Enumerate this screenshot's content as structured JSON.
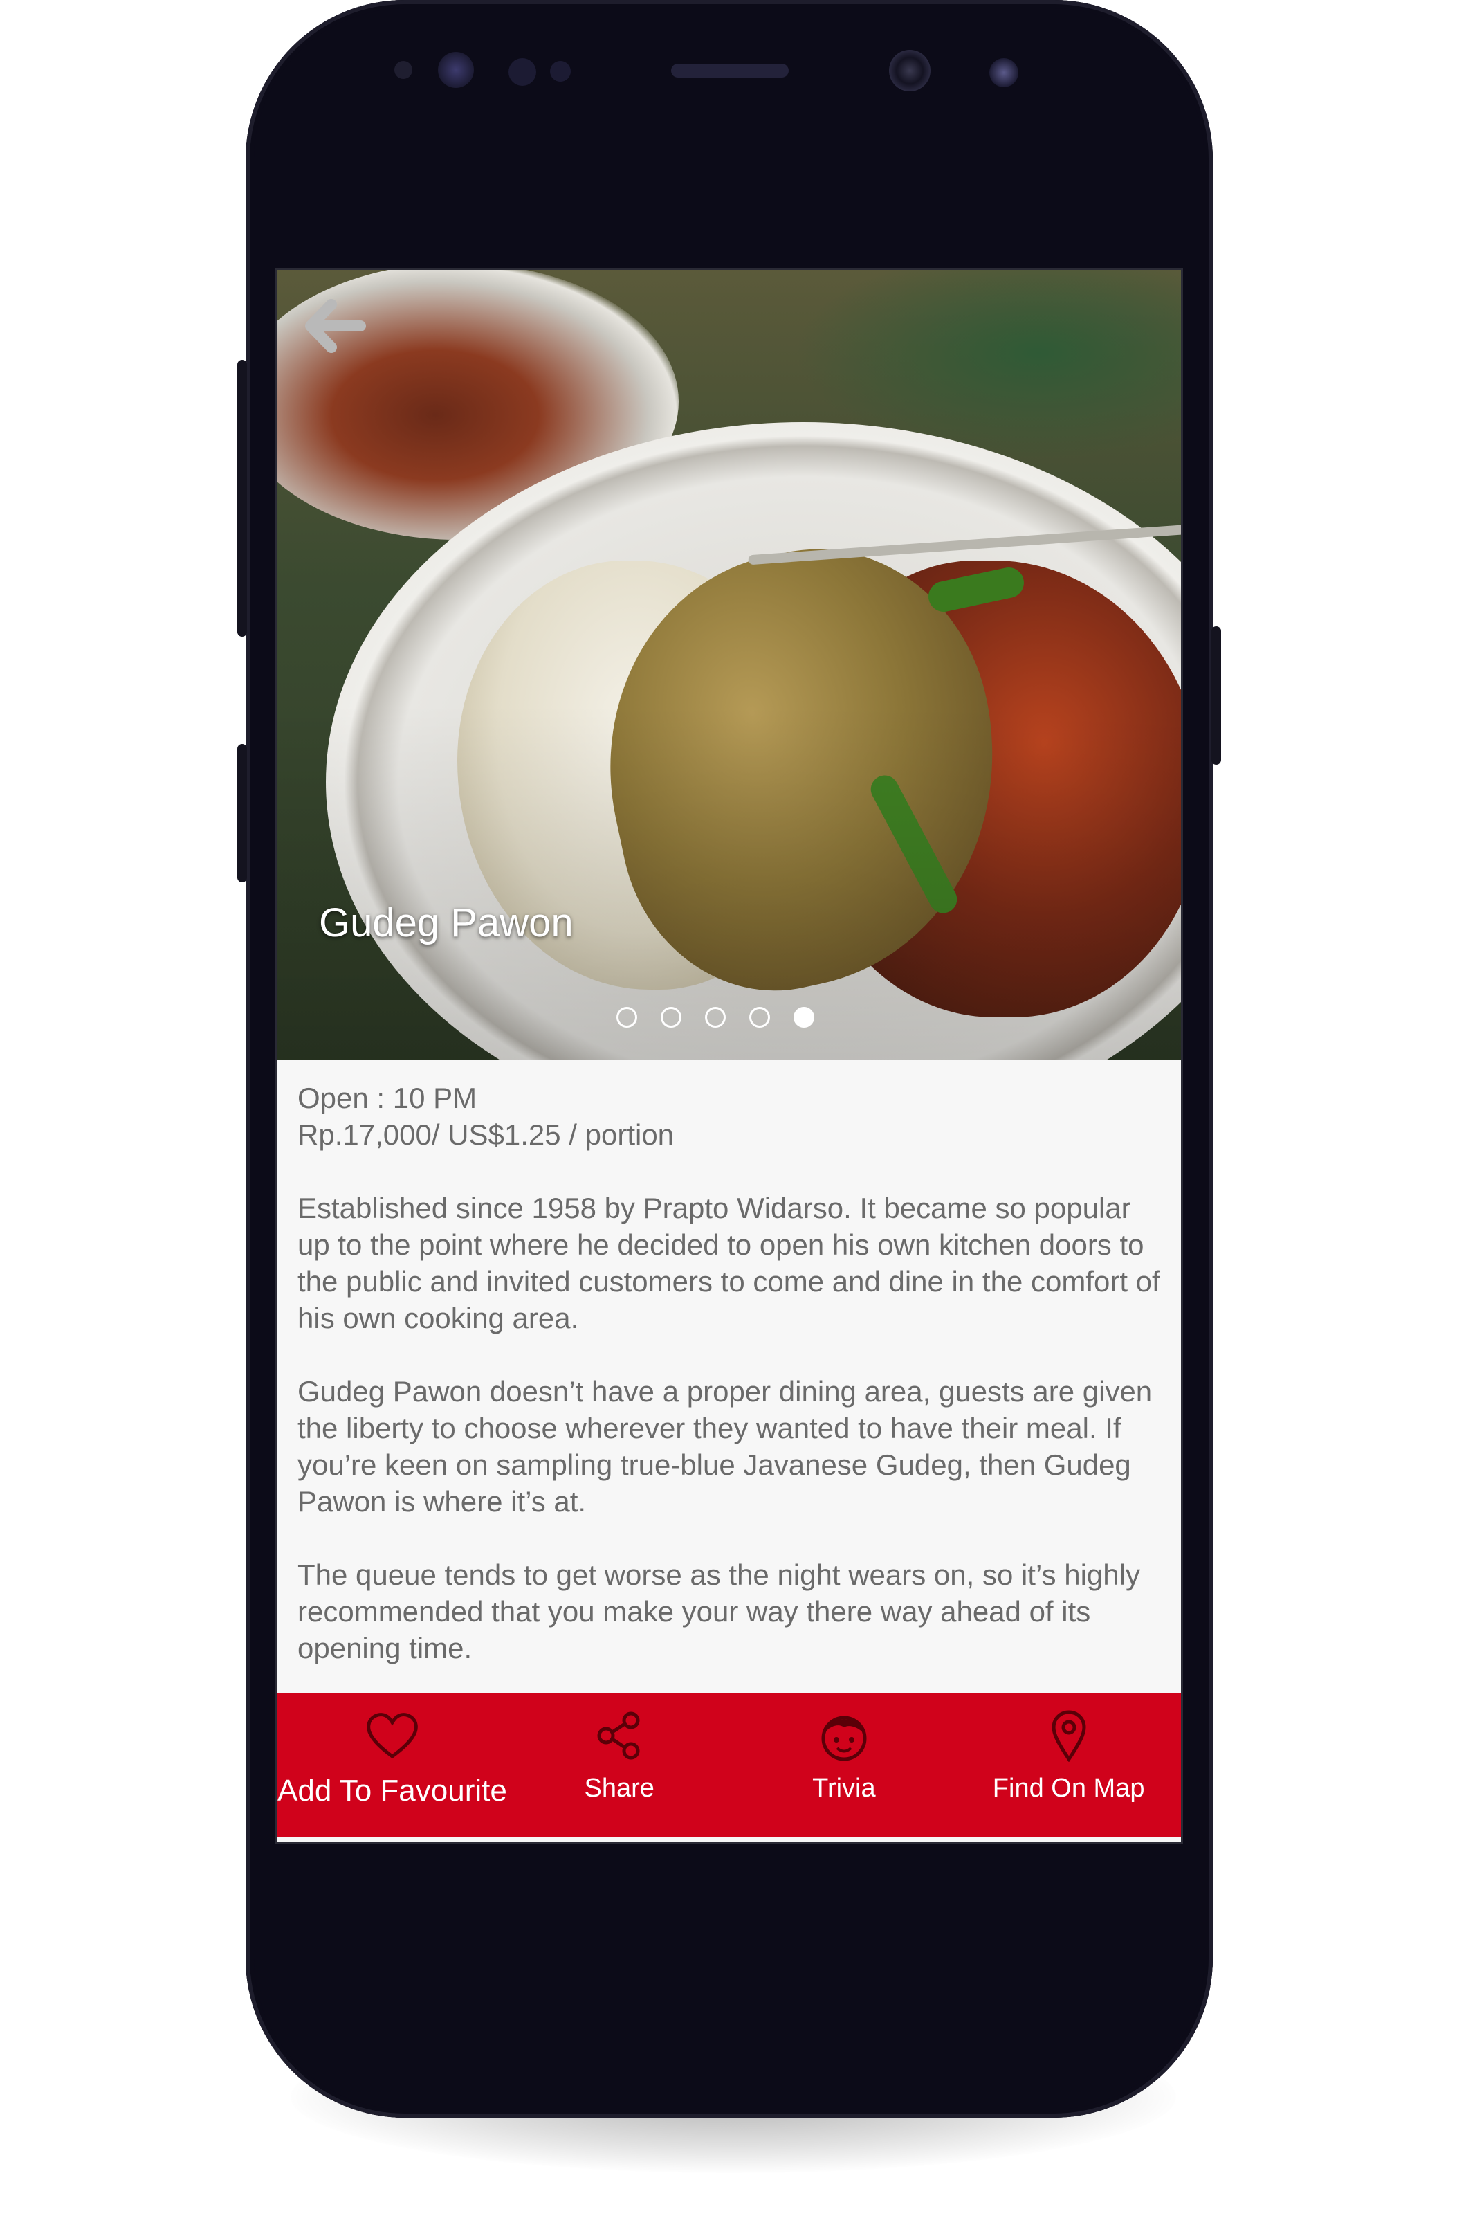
{
  "restaurant": {
    "name": "Gudeg Pawon",
    "open": "Open : 10 PM",
    "price": "Rp.17,000/ US$1.25 / portion",
    "description": [
      "Established since 1958 by Prapto Widarso. It became so popular up to the point where he decided to open his own kitchen doors to the public and invited customers to come and dine in the comfort of his own cooking area.",
      "Gudeg Pawon doesn’t have a proper dining area, guests are given the liberty to choose wherever they wanted to have their meal. If you’re keen on sampling true-blue Javanese Gudeg, then Gudeg Pawon is where it’s at.",
      "The queue tends to get worse as the night wears on, so it’s highly recommended that you make your way there way ahead of its opening time."
    ]
  },
  "carousel": {
    "count": 5,
    "active_index": 4
  },
  "icons": {
    "back": "arrow-left-icon",
    "favourite": "heart-icon",
    "share": "share-icon",
    "trivia": "face-icon",
    "map": "map-pin-icon"
  },
  "bottom_nav": {
    "favourite": "Add To Favourite",
    "share": "Share",
    "trivia": "Trivia",
    "map": "Find On Map"
  },
  "colors": {
    "accent": "#d0021b",
    "text": "#6a6a6a",
    "background": "#f7f7f7",
    "device": "#0c0b18"
  }
}
